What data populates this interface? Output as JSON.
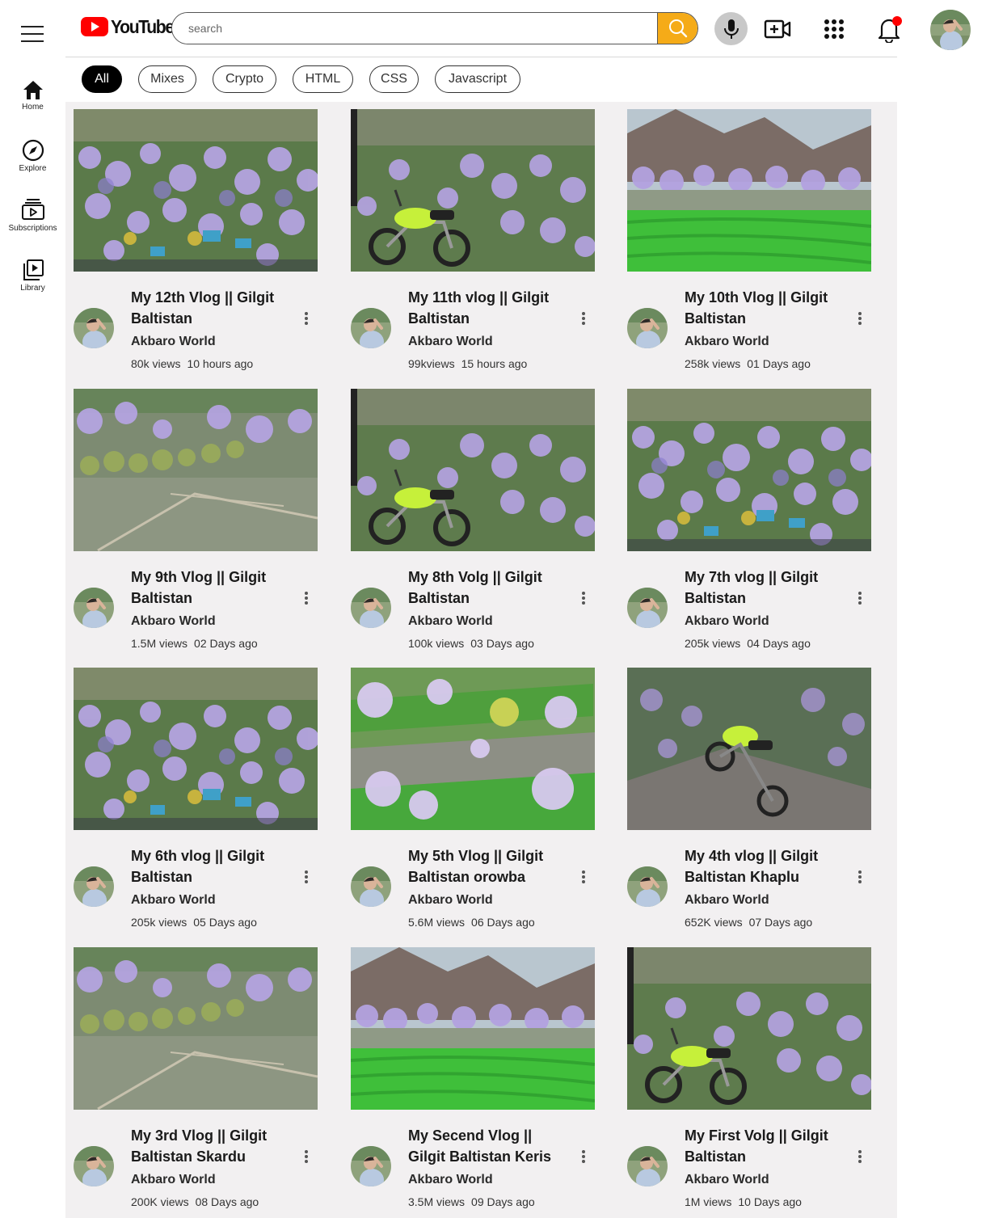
{
  "header": {
    "logo_text": "YouTube",
    "search_placeholder": "search",
    "icons": [
      "menu-icon",
      "search-icon",
      "mic-icon",
      "create-video-icon",
      "apps-grid-icon",
      "bell-icon",
      "avatar"
    ],
    "accent_search": "#f5ab18",
    "logo_red": "#ff0000",
    "notification_dot": "#ff0000"
  },
  "sidebar": {
    "items": [
      {
        "label": "Home",
        "icon": "home-icon"
      },
      {
        "label": "Explore",
        "icon": "compass-icon"
      },
      {
        "label": "Subscriptions",
        "icon": "subscriptions-icon"
      },
      {
        "label": "Library",
        "icon": "library-icon"
      }
    ]
  },
  "chips": [
    {
      "label": "All",
      "active": true
    },
    {
      "label": "Mixes",
      "active": false
    },
    {
      "label": "Crypto",
      "active": false
    },
    {
      "label": "HTML",
      "active": false
    },
    {
      "label": "CSS",
      "active": false
    },
    {
      "label": "Javascript",
      "active": false
    }
  ],
  "videos": [
    {
      "title": "My 12th Vlog || Gilgit Baltistan",
      "channel": "Akbaro World",
      "views": "80k views",
      "age": "10 hours ago",
      "thumb": "village"
    },
    {
      "title": "My 11th vlog || Gilgit Baltistan",
      "channel": "Akbaro World",
      "views": "99kviews",
      "age": "15 hours ago",
      "thumb": "bike"
    },
    {
      "title": "My 10th Vlog || Gilgit Baltistan",
      "channel": "Akbaro World",
      "views": "258k views",
      "age": "01 Days ago",
      "thumb": "field"
    },
    {
      "title": "My 9th Vlog || Gilgit Baltistan",
      "channel": "Akbaro World",
      "views": "1.5M views",
      "age": "02 Days ago",
      "thumb": "valley"
    },
    {
      "title": "My 8th Volg || Gilgit Baltistan",
      "channel": "Akbaro World",
      "views": "100k views",
      "age": "03 Days ago",
      "thumb": "bike"
    },
    {
      "title": "My 7th vlog || Gilgit Baltistan",
      "channel": "Akbaro World",
      "views": "205k views",
      "age": "04 Days ago",
      "thumb": "village"
    },
    {
      "title": "My 6th vlog || Gilgit Baltistan",
      "channel": "Akbaro World",
      "views": "205k views",
      "age": "05 Days ago",
      "thumb": "village"
    },
    {
      "title": "My 5th Vlog || Gilgit Baltistan orowba",
      "channel": "Akbaro World",
      "views": "5.6M views",
      "age": "06 Days ago",
      "thumb": "terraces"
    },
    {
      "title": "My 4th vlog || Gilgit Baltistan Khaplu",
      "channel": "Akbaro World",
      "views": "652K views",
      "age": "07 Days ago",
      "thumb": "rockbike"
    },
    {
      "title": "My 3rd Vlog || Gilgit Baltistan Skardu",
      "channel": "Akbaro World",
      "views": "200K views",
      "age": "08 Days ago",
      "thumb": "valley"
    },
    {
      "title": "My Secend Vlog || Gilgit Baltistan Keris",
      "channel": "Akbaro World",
      "views": "3.5M views",
      "age": "09 Days ago",
      "thumb": "field"
    },
    {
      "title": "My First Volg || Gilgit Baltistan",
      "channel": "Akbaro World",
      "views": "1M views",
      "age": "10 Days ago",
      "thumb": "bike"
    }
  ]
}
